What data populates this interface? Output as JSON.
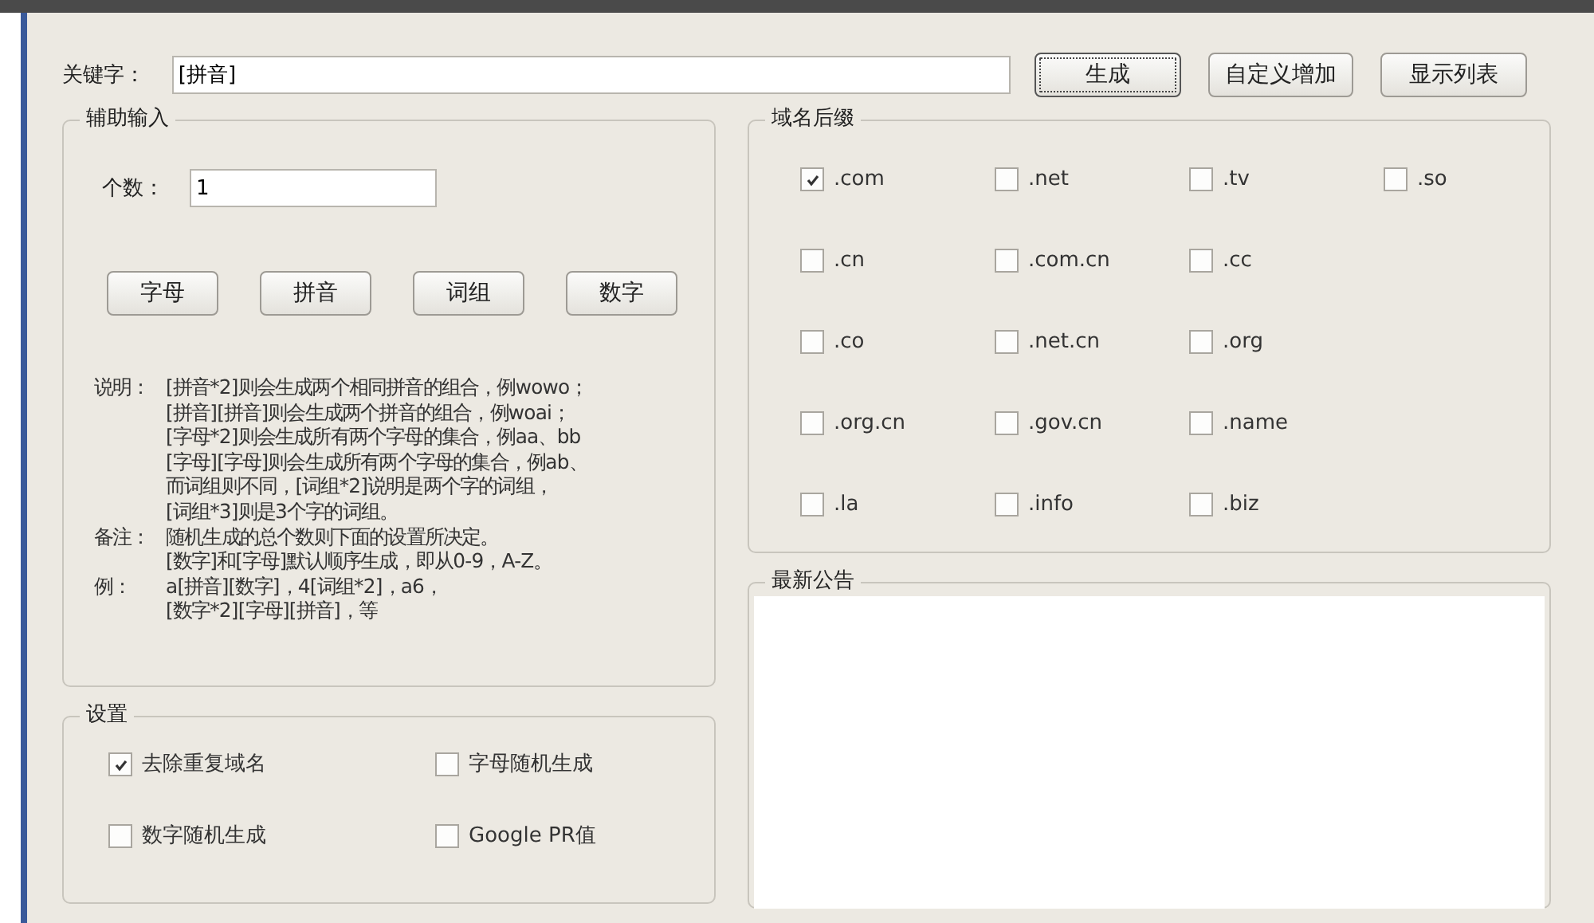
{
  "keyword": {
    "label": "关键字：",
    "value": "[拼音]"
  },
  "top_buttons": [
    {
      "label": "生成",
      "focused": true
    },
    {
      "label": "自定义增加",
      "focused": false
    },
    {
      "label": "显示列表",
      "focused": false
    }
  ],
  "assist": {
    "title": "辅助输入",
    "count_label": "个数：",
    "count_value": "1",
    "buttons": [
      "字母",
      "拼音",
      "词组",
      "数字"
    ],
    "notes": [
      {
        "label": "说明：",
        "lines": [
          "[拼音*2]则会生成两个相同拼音的组合，例wowo；",
          "[拼音][拼音]则会生成两个拼音的组合，例woai；",
          "[字母*2]则会生成所有两个字母的集合，例aa、bb",
          "[字母][字母]则会生成所有两个字母的集合，例ab、",
          "而词组则不同，[词组*2]说明是两个字的词组，",
          "[词组*3]则是3个字的词组。"
        ]
      },
      {
        "label": "备注：",
        "lines": [
          "随机生成的总个数则下面的设置所决定。",
          "[数字]和[字母]默认顺序生成，即从0-9，A-Z。"
        ]
      },
      {
        "label": "例：",
        "lines": [
          "a[拼音][数字]，4[词组*2]，a6，",
          "[数字*2][字母][拼音]，等"
        ]
      }
    ]
  },
  "settings": {
    "title": "设置",
    "options": [
      {
        "label": "去除重复域名",
        "checked": true
      },
      {
        "label": "字母随机生成",
        "checked": false
      },
      {
        "label": "数字随机生成",
        "checked": false
      },
      {
        "label": "Google PR值",
        "checked": false
      }
    ]
  },
  "suffixes": {
    "title": "域名后缀",
    "rows": [
      [
        {
          "label": ".com",
          "checked": true
        },
        {
          "label": ".net",
          "checked": false
        },
        {
          "label": ".tv",
          "checked": false
        },
        {
          "label": ".so",
          "checked": false
        }
      ],
      [
        {
          "label": ".cn",
          "checked": false
        },
        {
          "label": ".com.cn",
          "checked": false
        },
        {
          "label": ".cc",
          "checked": false
        }
      ],
      [
        {
          "label": ".co",
          "checked": false
        },
        {
          "label": ".net.cn",
          "checked": false
        },
        {
          "label": ".org",
          "checked": false
        }
      ],
      [
        {
          "label": ".org.cn",
          "checked": false
        },
        {
          "label": ".gov.cn",
          "checked": false
        },
        {
          "label": ".name",
          "checked": false
        }
      ],
      [
        {
          "label": ".la",
          "checked": false
        },
        {
          "label": ".info",
          "checked": false
        },
        {
          "label": ".biz",
          "checked": false
        }
      ]
    ]
  },
  "announcements": {
    "title": "最新公告"
  }
}
